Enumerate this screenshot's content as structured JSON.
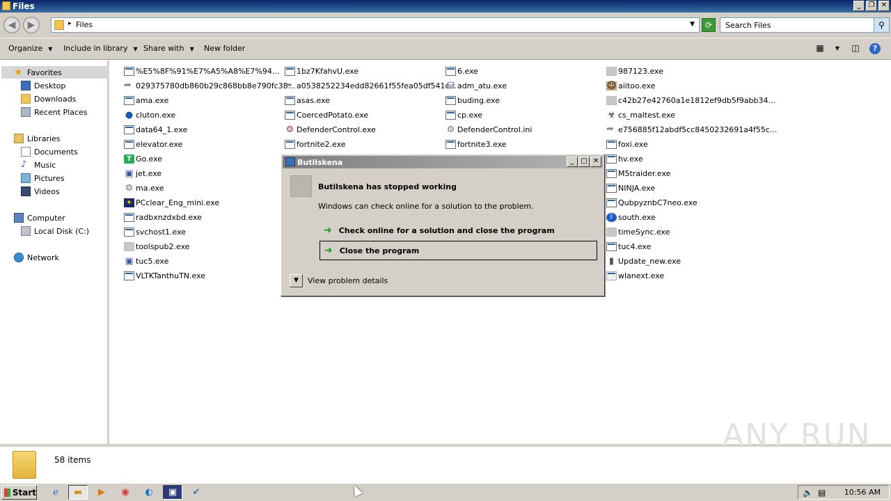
{
  "window": {
    "title": "Files"
  },
  "address": {
    "path": "Files",
    "search_placeholder": "Search Files"
  },
  "toolbar": {
    "organize": "Organize",
    "include_in_library": "Include in library",
    "share_with": "Share with",
    "new_folder": "New folder"
  },
  "nav": {
    "favorites": "Favorites",
    "desktop": "Desktop",
    "downloads": "Downloads",
    "recent_places": "Recent Places",
    "libraries": "Libraries",
    "documents": "Documents",
    "music": "Music",
    "pictures": "Pictures",
    "videos": "Videos",
    "computer": "Computer",
    "local_disk": "Local Disk (C:)",
    "network": "Network"
  },
  "files": {
    "col1": [
      "%E5%8F%91%E7%A5%A8%E7%94...",
      "029375780db860b29c868bb8e790fc38...",
      "ama.exe",
      "cluton.exe",
      "data64_1.exe",
      "elevator.exe",
      "Go.exe",
      "jet.exe",
      "ma.exe",
      "PCclear_Eng_mini.exe",
      "radbxnzdxbd.exe",
      "svchost1.exe",
      "toolspub2.exe",
      "tuc5.exe",
      "VLTKTanthuTN.exe"
    ],
    "col2": [
      "1bz7KfahvU.exe",
      "a0538252234edd82661f55fea05df541c...",
      "asas.exe",
      "CoercedPotato.exe",
      "DefenderControl.exe",
      "fortnite2.exe"
    ],
    "col3": [
      "6.exe",
      "adm_atu.exe",
      "buding.exe",
      "cp.exe",
      "DefenderControl.ini",
      "fortnite3.exe"
    ],
    "col4": [
      "987123.exe",
      "aiitoo.exe",
      "c42b27e42760a1e1812ef9db5f9abb34...",
      "cs_maltest.exe",
      "e756885f12abdf5cc8450232691a4f55c...",
      "foxi.exe",
      "hv.exe",
      "M5traider.exe",
      "NINJA.exe",
      "QubpyznbC7neo.exe",
      "south.exe",
      "timeSync.exe",
      "tuc4.exe",
      "Update_new.exe",
      "wlanext.exe"
    ]
  },
  "status": {
    "count": "58 items"
  },
  "watermark": "ANY RUN",
  "dialog": {
    "title": "Butilskena",
    "heading": "Butilskena has stopped working",
    "message": "Windows can check online for a solution to the problem.",
    "option_check": "Check online for a solution and close the program",
    "option_close": "Close the program",
    "details": "View problem details"
  },
  "taskbar": {
    "start": "Start",
    "clock": "10:56 AM"
  }
}
